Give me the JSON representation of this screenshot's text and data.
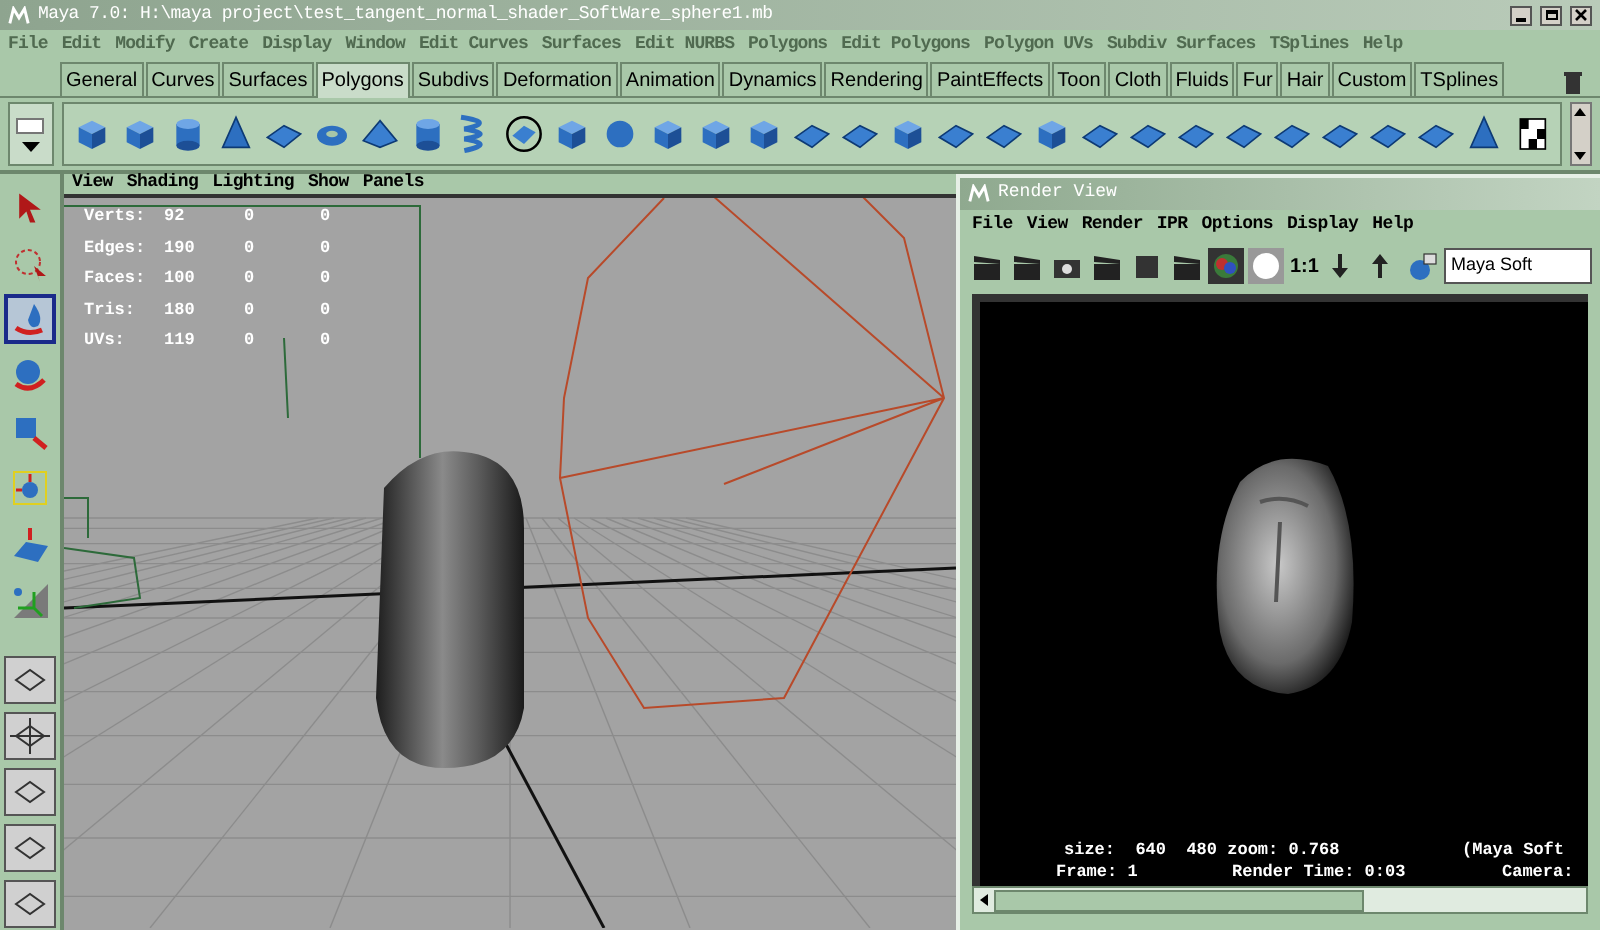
{
  "window": {
    "title": "Maya 7.0: H:\\maya project\\test_tangent_normal_shader_SoftWare_sphere1.mb"
  },
  "menu": [
    "File",
    "Edit",
    "Modify",
    "Create",
    "Display",
    "Window",
    "Edit Curves",
    "Surfaces",
    "Edit NURBS",
    "Polygons",
    "Edit Polygons",
    "Polygon UVs",
    "Subdiv Surfaces",
    "TSplines",
    "Help"
  ],
  "shelf_tabs": [
    {
      "label": "General",
      "selected": false
    },
    {
      "label": "Curves",
      "selected": false
    },
    {
      "label": "Surfaces",
      "selected": false
    },
    {
      "label": "Polygons",
      "selected": true
    },
    {
      "label": "Subdivs",
      "selected": false
    },
    {
      "label": "Deformation",
      "selected": false
    },
    {
      "label": "Animation",
      "selected": false
    },
    {
      "label": "Dynamics",
      "selected": false
    },
    {
      "label": "Rendering",
      "selected": false
    },
    {
      "label": "PaintEffects",
      "selected": false
    },
    {
      "label": "Toon",
      "selected": false
    },
    {
      "label": "Cloth",
      "selected": false
    },
    {
      "label": "Fluids",
      "selected": false
    },
    {
      "label": "Fur",
      "selected": false
    },
    {
      "label": "Hair",
      "selected": false
    },
    {
      "label": "Custom",
      "selected": false
    },
    {
      "label": "TSplines",
      "selected": false
    }
  ],
  "tools": [
    {
      "kind": "select",
      "selected": false
    },
    {
      "kind": "lasso",
      "selected": false
    },
    {
      "kind": "paint",
      "selected": true
    },
    {
      "kind": "rotate",
      "selected": false
    },
    {
      "kind": "move",
      "selected": false
    },
    {
      "kind": "manip",
      "selected": false
    },
    {
      "kind": "plane",
      "selected": false
    },
    {
      "kind": "axis",
      "selected": false
    }
  ],
  "viewport": {
    "menu": [
      "View",
      "Shading",
      "Lighting",
      "Show",
      "Panels"
    ],
    "stats": [
      {
        "label": "Verts:",
        "values": [
          "92",
          "0",
          "0"
        ]
      },
      {
        "label": "Edges:",
        "values": [
          "190",
          "0",
          "0"
        ]
      },
      {
        "label": "Faces:",
        "values": [
          "100",
          "0",
          "0"
        ]
      },
      {
        "label": "Tris:",
        "values": [
          "180",
          "0",
          "0"
        ]
      },
      {
        "label": "UVs:",
        "values": [
          "119",
          "0",
          "0"
        ]
      }
    ]
  },
  "render_view": {
    "title": "Render View",
    "menu": [
      "File",
      "View",
      "Render",
      "IPR",
      "Options",
      "Display",
      "Help"
    ],
    "ratio_button": "1:1",
    "renderer_field": "Maya Soft",
    "info": [
      [
        "size:  640  480 zoom: 0.768",
        "(Maya Soft"
      ],
      [
        "Frame: 1",
        "Render Time: 0:03",
        "Camera:"
      ]
    ]
  }
}
